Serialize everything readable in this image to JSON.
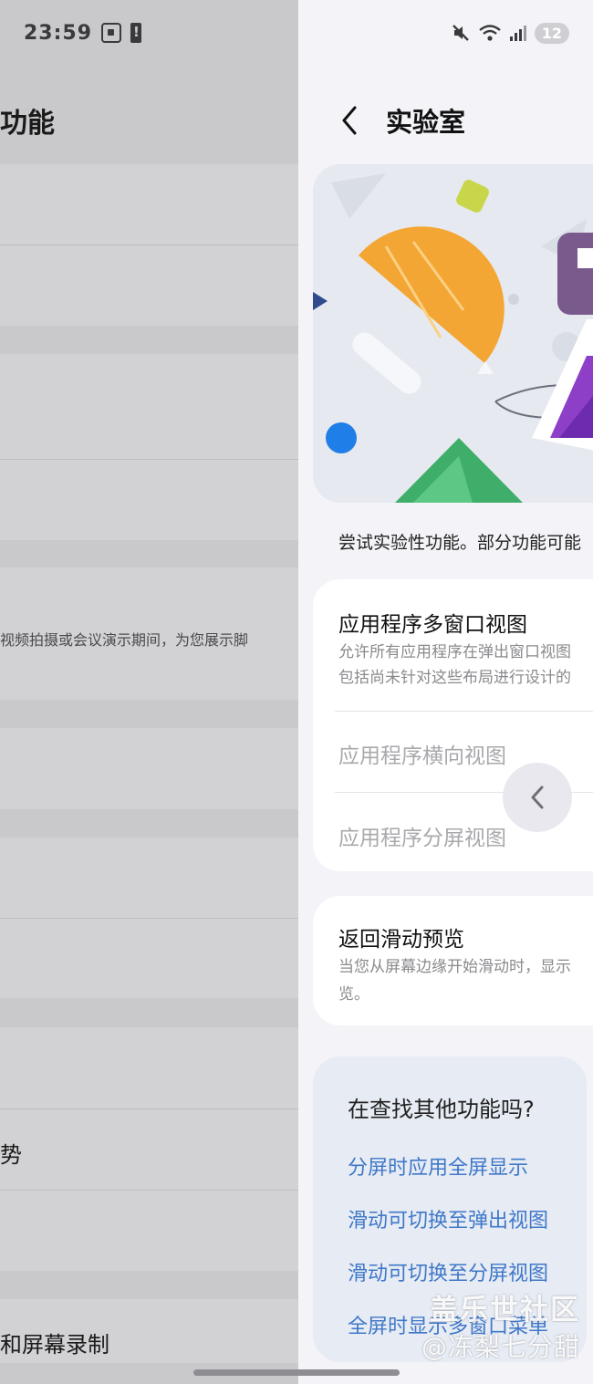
{
  "left_panel": {
    "status_time": "23:59",
    "title": "功能",
    "description_row": "视频拍摄或会议演示期间，为您展示脚",
    "row_partial_a": "势",
    "row_partial_b": "和屏幕录制"
  },
  "right_panel": {
    "status_badge": "12",
    "header_title": "实验室",
    "intro": "尝试实验性功能。部分功能可能",
    "card1": {
      "title": "应用程序多窗口视图",
      "subtitle_line1": "允许所有应用程序在弹出窗口视图",
      "subtitle_line2": "包括尚未针对这些布局进行设计的",
      "option1": "应用程序横向视图",
      "option2": "应用程序分屏视图"
    },
    "card2": {
      "title": "返回滑动预览",
      "subtitle_line1": "当您从屏幕边缘开始滑动时，显示",
      "subtitle_line2": "览。"
    },
    "more": {
      "title": "在查找其他功能吗?",
      "links": [
        "分屏时应用全屏显示",
        "滑动可切换至弹出视图",
        "滑动可切换至分屏视图",
        "全屏时显示多窗口菜单"
      ]
    }
  },
  "watermark": {
    "line1": "盖乐世社区",
    "line2": "@冻梨七分甜"
  },
  "colors": {
    "link_blue": "#3f78c9",
    "dim_panel": "#c9c9cc",
    "card_bg": "#ffffff",
    "more_bg": "#e7ebf3"
  },
  "icons": [
    "screenshot-icon",
    "battery-alert-icon",
    "mute-icon",
    "wifi-icon",
    "signal-icon",
    "back-arrow-icon",
    "chevron-left-icon"
  ]
}
